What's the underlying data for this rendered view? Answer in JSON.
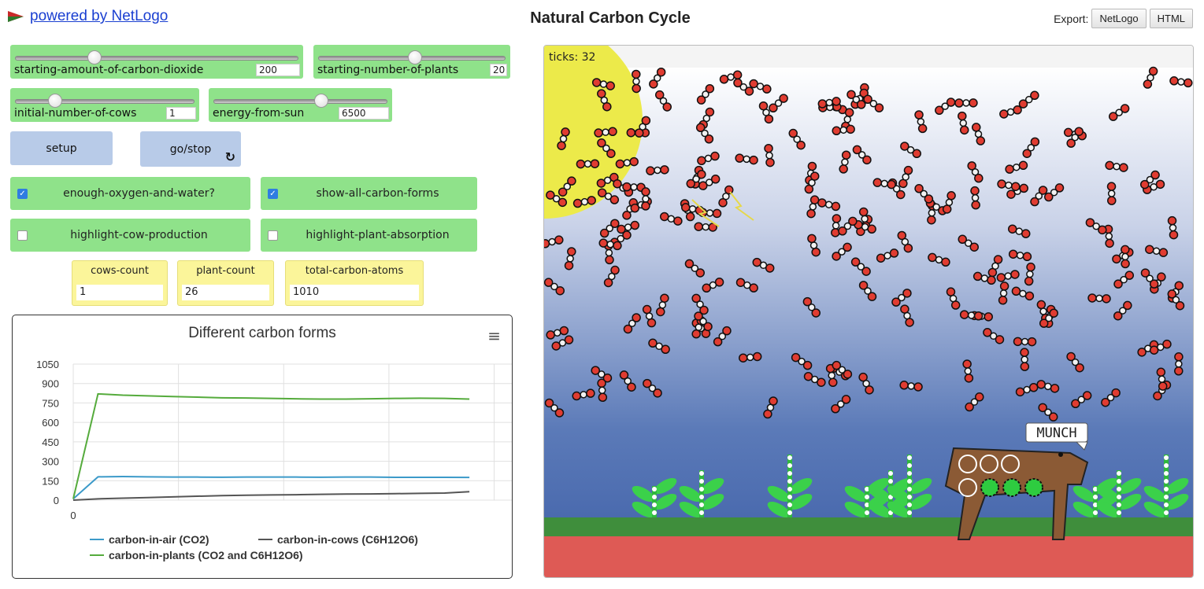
{
  "header": {
    "powered_label": "powered by NetLogo",
    "title": "Natural Carbon Cycle",
    "export_label": "Export:",
    "export_buttons": [
      "NetLogo",
      "HTML"
    ]
  },
  "sliders": [
    {
      "label": "starting-amount-of-carbon-dioxide",
      "value": "200",
      "fraction": 0.27
    },
    {
      "label": "starting-number-of-plants",
      "value": "20",
      "fraction": 0.52
    },
    {
      "label": "initial-number-of-cows",
      "value": "1",
      "fraction": 0.2
    },
    {
      "label": "energy-from-sun",
      "value": "6500",
      "fraction": 0.63
    }
  ],
  "buttons": {
    "setup": "setup",
    "go": "go/stop"
  },
  "switches": [
    {
      "label": "enough-oxygen-and-water?",
      "on": true
    },
    {
      "label": "show-all-carbon-forms",
      "on": true
    },
    {
      "label": "highlight-cow-production",
      "on": false
    },
    {
      "label": "highlight-plant-absorption",
      "on": false
    }
  ],
  "monitors": [
    {
      "label": "cows-count",
      "value": "1"
    },
    {
      "label": "plant-count",
      "value": "26"
    },
    {
      "label": "total-carbon-atoms",
      "value": "1010"
    }
  ],
  "plot": {
    "title": "Different carbon forms",
    "legend": [
      "carbon-in-air (CO2)",
      "carbon-in-cows (C6H12O6)",
      "carbon-in-plants (CO2 and C6H12O6)"
    ]
  },
  "colors": {
    "air": "#3c9ac9",
    "cows": "#555555",
    "plants": "#55ab3c",
    "widget_green": "#8fe28a",
    "button_blue": "#b8cbe8",
    "monitor_yellow": "#fbf59a"
  },
  "chart_data": {
    "type": "line",
    "title": "Different carbon forms",
    "x": [
      0,
      2,
      4,
      6,
      8,
      10,
      12,
      14,
      16,
      18,
      20,
      22,
      24,
      26,
      28,
      30,
      32
    ],
    "xticks": [
      0
    ],
    "yticks": [
      0,
      150,
      300,
      450,
      600,
      750,
      900,
      1050
    ],
    "ylim": [
      0,
      1050
    ],
    "series": [
      {
        "name": "carbon-in-air (CO2)",
        "values": [
          10,
          180,
          182,
          180,
          178,
          178,
          177,
          178,
          178,
          178,
          177,
          178,
          178,
          176,
          176,
          176,
          175
        ]
      },
      {
        "name": "carbon-in-cows (C6H12O6)",
        "values": [
          0,
          10,
          15,
          20,
          25,
          30,
          35,
          38,
          40,
          42,
          45,
          47,
          48,
          50,
          52,
          55,
          65
        ]
      },
      {
        "name": "carbon-in-plants (CO2 and C6H12O6)",
        "values": [
          10,
          820,
          810,
          805,
          800,
          795,
          790,
          788,
          785,
          782,
          780,
          780,
          782,
          785,
          787,
          785,
          780
        ]
      }
    ],
    "grid": true,
    "legend_position": "bottom"
  },
  "view": {
    "ticks_label": "ticks: 32",
    "munch_label": "MUNCH"
  }
}
